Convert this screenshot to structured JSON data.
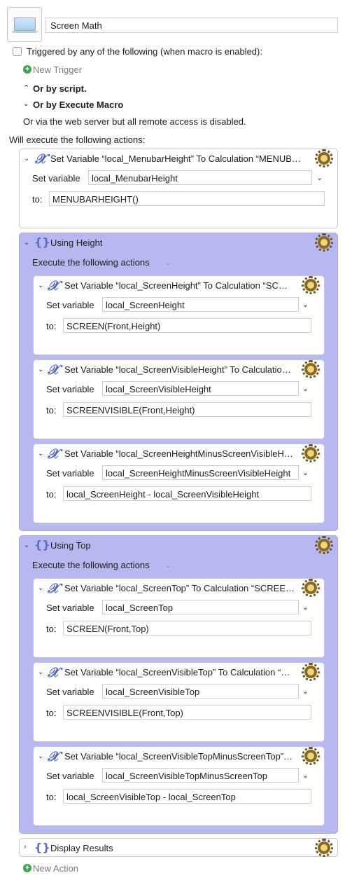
{
  "macro": {
    "name": "Screen Math",
    "trigger_label": "Triggered by any of the following (when macro is enabled):",
    "new_trigger": "New Trigger",
    "or_by_script": "Or by script.",
    "or_by_execute_macro": "Or by Execute Macro",
    "web_server_note": "Or via the web server but all remote access is disabled.",
    "will_execute": "Will execute the following actions:",
    "new_action": "New Action"
  },
  "labels": {
    "set_variable": "Set variable",
    "to": "to:",
    "execute_following": "Execute the following actions"
  },
  "actions": {
    "menubar": {
      "title": "Set Variable “local_MenubarHeight” To Calculation “MENUB…",
      "variable": "local_MenubarHeight",
      "value": "MENUBARHEIGHT()"
    },
    "using_height": {
      "title": "Using Height",
      "items": [
        {
          "title": "Set Variable “local_ScreenHeight” To Calculation “SC…",
          "variable": "local_ScreenHeight",
          "value": "SCREEN(Front,Height)"
        },
        {
          "title": "Set Variable “local_ScreenVisibleHeight” To Calculatio…",
          "variable": "local_ScreenVisibleHeight",
          "value": "SCREENVISIBLE(Front,Height)"
        },
        {
          "title": "Set Variable “local_ScreenHeightMinusScreenVisibleH…",
          "variable": "local_ScreenHeightMinusScreenVisibleHeight",
          "value": "local_ScreenHeight - local_ScreenVisibleHeight"
        }
      ]
    },
    "using_top": {
      "title": "Using Top",
      "items": [
        {
          "title": "Set Variable “local_ScreenTop” To Calculation “SCREE…",
          "variable": "local_ScreenTop",
          "value": "SCREEN(Front,Top)"
        },
        {
          "title": "Set Variable “local_ScreenVisibleTop” To Calculation “…",
          "variable": "local_ScreenVisibleTop",
          "value": "SCREENVISIBLE(Front,Top)"
        },
        {
          "title": "Set Variable “local_ScreenVisibleTopMinusScreenTop”…",
          "variable": "local_ScreenVisibleTopMinusScreenTop",
          "value": "local_ScreenVisibleTop - local_ScreenTop"
        }
      ]
    },
    "display_results": {
      "title": "Display Results"
    }
  },
  "icons": {
    "variable": "x-variable-icon",
    "group": "braces-group-icon",
    "gear": "gear-icon"
  },
  "colors": {
    "group_bg": "#b7b8ef",
    "accent": "#4d63c4",
    "add_green": "#3aa84a"
  }
}
